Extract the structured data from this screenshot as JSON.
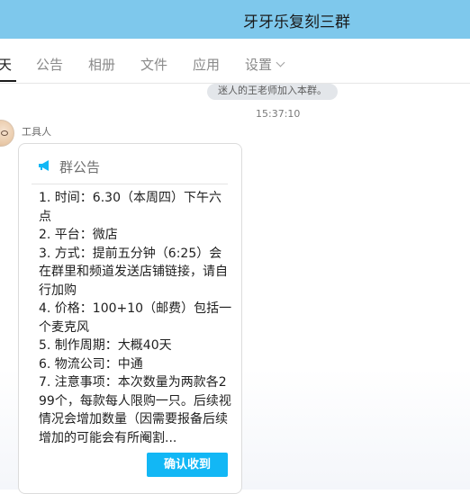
{
  "window": {
    "title": "牙牙乐复刻三群"
  },
  "tabs": [
    {
      "label": "天",
      "active": true
    },
    {
      "label": "公告"
    },
    {
      "label": "相册"
    },
    {
      "label": "文件"
    },
    {
      "label": "应用"
    },
    {
      "label": "设置"
    }
  ],
  "chat": {
    "system_message": "迷人的王老师加入本群。",
    "timestamp": "15:37:10",
    "sender": "工具人",
    "announcement": {
      "header": "群公告",
      "lines": [
        "1. 时间：6.30（本周四）下午六点",
        "2. 平台：微店",
        "3. 方式：提前五分钟（6:25）会在群里和频道发送店铺链接，请自行加购",
        "4. 价格：100+10（邮费）包括一个麦克风",
        "5. 制作周期：大概40天",
        "6. 物流公司：中通",
        "7. 注意事项：本次数量为两款各299个，每款每人限购一只。后续视情况会增加数量（因需要报备后续增加的可能会有所阉割..."
      ],
      "confirm_label": "确认收到"
    }
  },
  "colors": {
    "header_bg": "#7ec8ec",
    "button_bg": "#12b7f5",
    "megaphone": "#12b7f5"
  },
  "icons": {
    "announcement": "megaphone-icon",
    "settings_dropdown": "chevron-down-icon"
  }
}
